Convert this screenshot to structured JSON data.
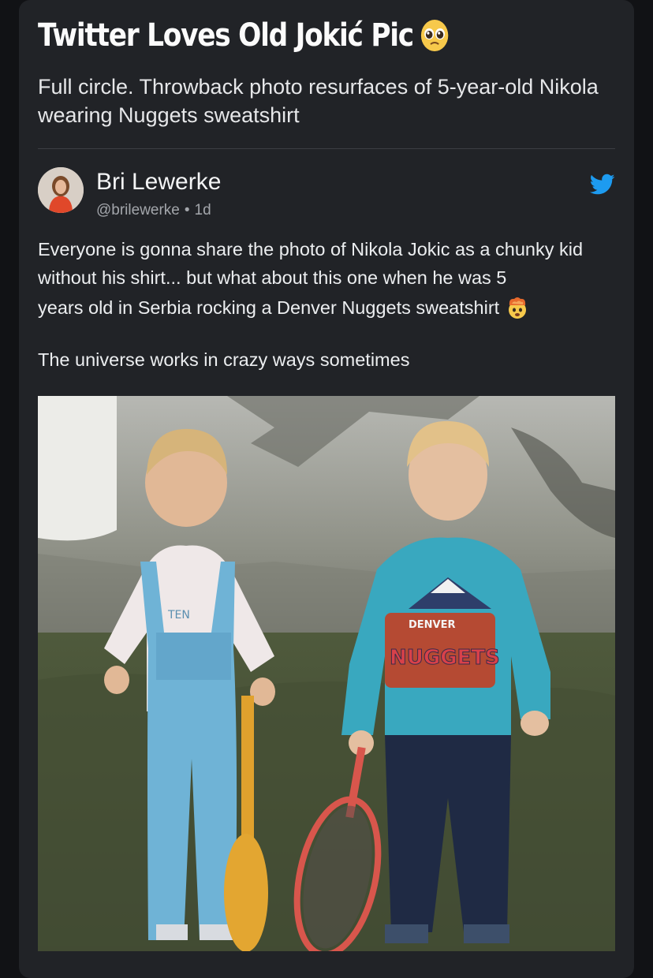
{
  "article": {
    "headline": "Twitter Loves Old Jokić Pic",
    "headline_emoji": "pleading-face-icon",
    "subheadline": "Full circle. Throwback photo resurfaces of 5-year-old Nikola wearing Nuggets sweatshirt"
  },
  "tweet": {
    "author_name": "Bri Lewerke",
    "handle": "@brilewerke",
    "separator": "•",
    "time": "1d",
    "text_line1": "Everyone is gonna share the photo of Nikola Jokic as a chunky kid without his shirt... but what about this one when he was 5",
    "text_line2": "years old in Serbia rocking a Denver Nuggets sweatshirt",
    "text_emoji": "exploding-head-icon",
    "text_line3": "The universe works in crazy ways sometimes",
    "platform_icon": "twitter-bird-icon"
  },
  "photo": {
    "sweatshirt_top": "DENVER",
    "sweatshirt_main": "NUGGETS",
    "overalls_print": "TEN"
  },
  "colors": {
    "card_bg": "#212327",
    "page_bg": "#111215",
    "twitter_blue": "#1d9bf0",
    "meta_gray": "#a3a6ab"
  }
}
